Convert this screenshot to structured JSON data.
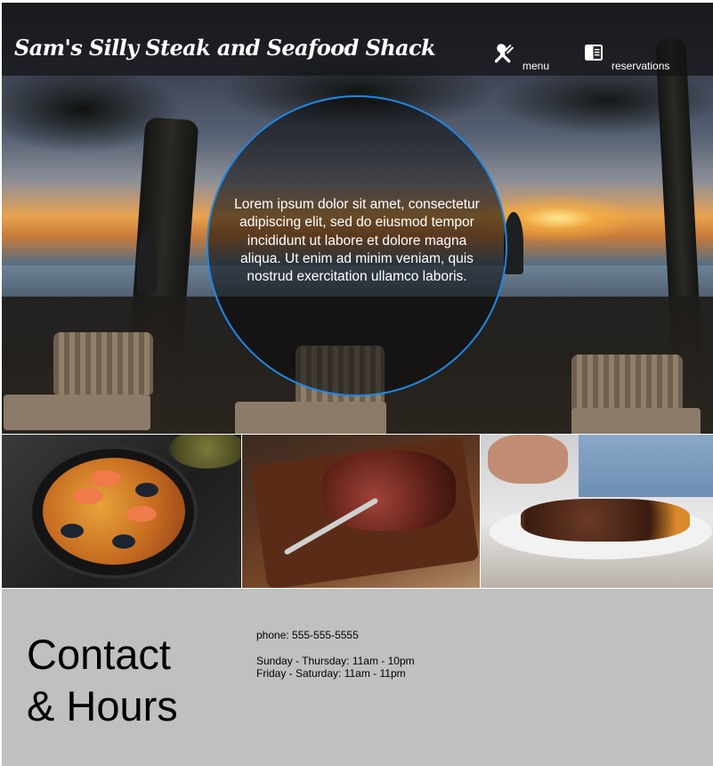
{
  "header": {
    "brand": "Sam's Silly Steak and Seafood Shack",
    "nav": [
      {
        "label": "menu",
        "icon": "utensils-icon"
      },
      {
        "label": "reservations",
        "icon": "book-icon"
      }
    ]
  },
  "hero": {
    "text": "Lorem ipsum dolor sit amet, consectetur adipiscing elit, sed do eiusmod tempor incididunt ut labore et dolore magna aliqua. Ut enim ad minim veniam, quis nostrud exercitation ullamco laboris.",
    "accent_color": "#1e88e5"
  },
  "photos": [
    {
      "subject": "paella-photo"
    },
    {
      "subject": "steak-photo"
    },
    {
      "subject": "plated-steak-photo"
    }
  ],
  "contact": {
    "title_line1": "Contact",
    "title_line2": "& Hours",
    "phone": "phone: 555-555-5555",
    "hours": [
      "Sunday - Thursday: 11am - 10pm",
      "Friday - Saturday: 11am - 11pm"
    ],
    "background": "#c0c0c0"
  }
}
